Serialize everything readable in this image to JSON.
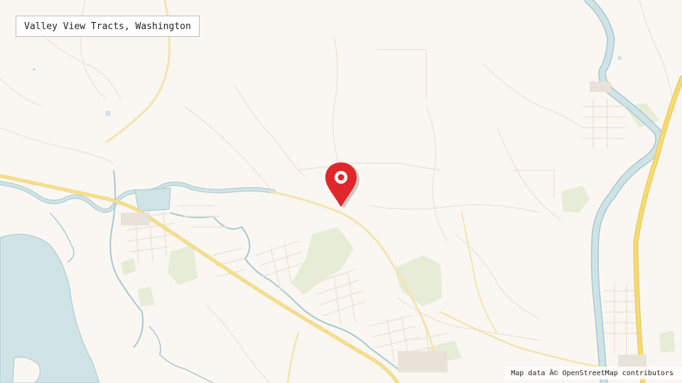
{
  "location": {
    "title": "Valley View Tracts, Washington"
  },
  "attribution": {
    "text": "Map data Â© OpenStreetMap contributors"
  },
  "marker": {
    "icon": "map-pin-icon",
    "color": "#e0272c"
  },
  "colors": {
    "land": "#faf7f2",
    "water": "#cfe3e6",
    "water_edge": "#a8c9cf",
    "park": "#e6ecd6",
    "road_major": "#f7df8b",
    "road_minor": "#eee7dc",
    "building": "#e9e2d8"
  }
}
